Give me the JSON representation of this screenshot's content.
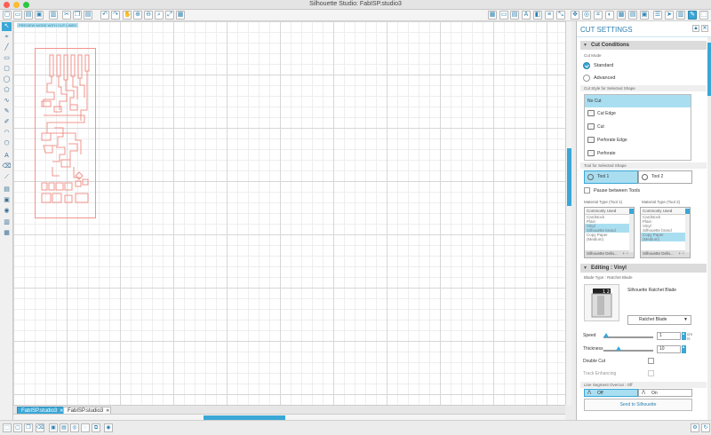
{
  "window": {
    "title": "Silhouette Studio: FabISP.studio3"
  },
  "canvas": {
    "preview_label": "PREVIEW MODE WITH CUT LINES"
  },
  "tabs": [
    {
      "label": "FabISP.studio3"
    },
    {
      "label": "FabISP.studio3"
    }
  ],
  "panel": {
    "title": "CUT SETTINGS",
    "cut_conditions": {
      "header": "Cut Conditions",
      "cut_mode_label": "Cut Mode",
      "standard": "Standard",
      "advanced": "Advanced",
      "cut_style_label": "Cut Style for Selected Shape",
      "styles": [
        "No Cut",
        "Cut Edge",
        "Cut",
        "Perforate Edge",
        "Perforate"
      ],
      "tool_label": "Tool for Selected Shape",
      "tool1": "Tool 1",
      "tool2": "Tool 2",
      "pause_between_tools": "Pause between Tools",
      "material_label_1": "Material Type (Tool 1)",
      "material_label_2": "Material Type (Tool 2)",
      "material_list": {
        "header": "Commonly Used",
        "items": [
          "Cardstock",
          "Plain",
          "Vinyl",
          "Silhouette brand",
          "Copy Paper",
          "(Medium)"
        ],
        "footer": "Silhouette Defa..."
      }
    },
    "editing": {
      "header": "Editing : Vinyl",
      "blade_type_label": "Blade Type : Ratchet Blade",
      "blade_name": "Silhouette Ratchet Blade",
      "blade_select": "Ratchet Blade",
      "speed_label": "Speed",
      "speed_value": "1",
      "speed_unit": "cm /s",
      "speed_level": 0.05,
      "thickness_label": "Thickness",
      "thickness_value": "10",
      "thickness_level": 0.3,
      "double_cut": "Double Cut",
      "track_enhancing": "Track Enhancing",
      "overcut_label": "Line Segment Overcut : Off",
      "off": "Off",
      "on": "On"
    },
    "send_button": "Send to Silhouette"
  },
  "colors": {
    "accent": "#3aa7d6",
    "cut_line": "#f0948c",
    "selection": "#a9def1"
  }
}
